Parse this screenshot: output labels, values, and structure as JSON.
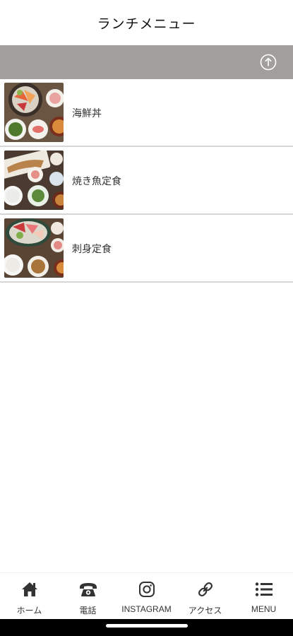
{
  "header": {
    "title": "ランチメニュー"
  },
  "subbar": {
    "scroll_top_icon": "arrow-up-circle-icon"
  },
  "menu_items": [
    {
      "label": "海鮮丼"
    },
    {
      "label": "焼き魚定食"
    },
    {
      "label": "刺身定食"
    }
  ],
  "bottom_nav": [
    {
      "label": "ホーム",
      "icon": "home-icon"
    },
    {
      "label": "電話",
      "icon": "telephone-icon"
    },
    {
      "label": "INSTAGRAM",
      "icon": "instagram-icon"
    },
    {
      "label": "アクセス",
      "icon": "link-icon"
    },
    {
      "label": "MENU",
      "icon": "menu-list-icon"
    }
  ],
  "colors": {
    "subbar": "#a19f9b",
    "divider": "#d6d6d6"
  }
}
